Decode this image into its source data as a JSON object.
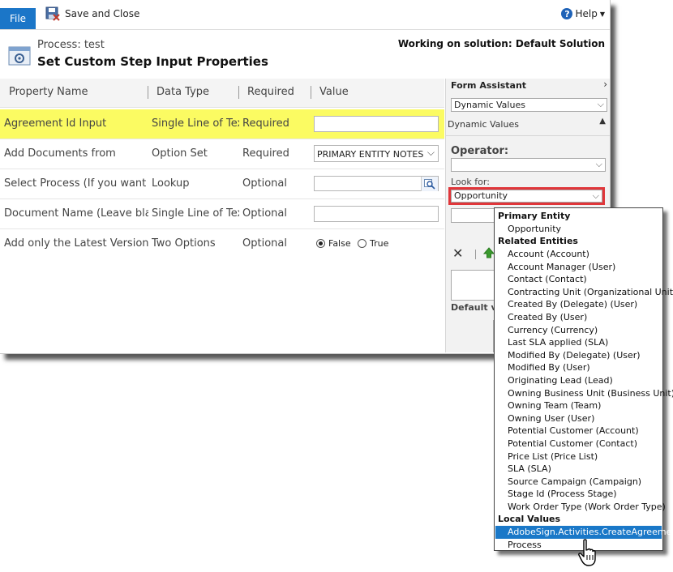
{
  "ribbon": {
    "file_label": "File",
    "save_close_label": "Save and Close",
    "help_label": "Help"
  },
  "header": {
    "process_label": "Process: test",
    "title": "Set Custom Step Input Properties",
    "solution_label": "Working on solution: Default Solution"
  },
  "grid": {
    "columns": [
      "Property Name",
      "Data Type",
      "Required",
      "Value"
    ],
    "rows": [
      {
        "name": "Agreement Id Input",
        "type": "Single Line of Text",
        "required": "Required",
        "value": ""
      },
      {
        "name": "Add Documents from",
        "type": "Option Set",
        "required": "Required",
        "value": "PRIMARY ENTITY NOTES"
      },
      {
        "name": "Select Process (If you want to...",
        "type": "Lookup",
        "required": "Optional",
        "value": ""
      },
      {
        "name": "Document Name (Leave blan...",
        "type": "Single Line of Text",
        "required": "Optional",
        "value": ""
      },
      {
        "name": "Add only the Latest Version...",
        "type": "Two Options",
        "required": "Optional",
        "value": "False"
      }
    ],
    "radio_false_label": "False",
    "radio_true_label": "True"
  },
  "form_assistant": {
    "title": "Form Assistant",
    "selector_value": "Dynamic Values",
    "section_label": "Dynamic Values",
    "operator_label": "Operator:",
    "operator_value": "",
    "look_for_label": "Look for:",
    "look_for_value": "Opportunity",
    "default_value_label": "Default va"
  },
  "dropdown": {
    "groups": [
      {
        "label": "Primary Entity",
        "items": [
          "Opportunity"
        ]
      },
      {
        "label": "Related Entities",
        "items": [
          "Account (Account)",
          "Account Manager (User)",
          "Contact (Contact)",
          "Contracting Unit (Organizational Unit)",
          "Created By (Delegate) (User)",
          "Created By (User)",
          "Currency (Currency)",
          "Last SLA applied (SLA)",
          "Modified By (Delegate) (User)",
          "Modified By (User)",
          "Originating Lead (Lead)",
          "Owning Business Unit (Business Unit)",
          "Owning Team (Team)",
          "Owning User (User)",
          "Potential Customer (Account)",
          "Potential Customer (Contact)",
          "Price List (Price List)",
          "SLA (SLA)",
          "Source Campaign (Campaign)",
          "Stage Id (Process Stage)",
          "Work Order Type (Work Order Type)"
        ]
      },
      {
        "label": "Local Values",
        "items": [
          "AdobeSign.Activities.CreateAgreement",
          "Process"
        ]
      }
    ],
    "selected_item": "AdobeSign.Activities.CreateAgreement"
  },
  "colors": {
    "accent": "#1b76c8",
    "highlight": "#fbfb62",
    "outline": "#e0363a",
    "selected": "#1a78c8"
  }
}
